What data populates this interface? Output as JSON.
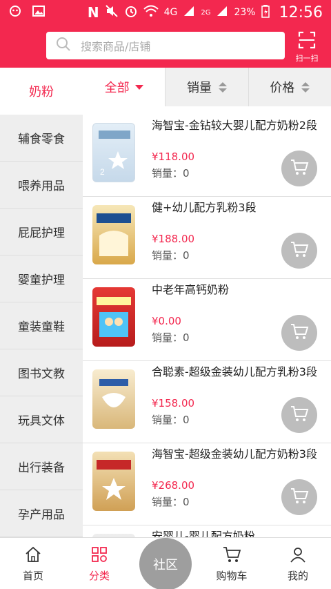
{
  "status_bar": {
    "network": "4G",
    "network2": "2G",
    "battery": "23%",
    "time": "12:56"
  },
  "header": {
    "search_placeholder": "搜索商品/店铺",
    "scan_label": "扫一扫"
  },
  "category": {
    "current": "奶粉",
    "filters": [
      {
        "label": "全部"
      },
      {
        "label": "销量"
      },
      {
        "label": "价格"
      }
    ]
  },
  "sidebar": {
    "items": [
      {
        "label": "辅食零食"
      },
      {
        "label": "喂养用品"
      },
      {
        "label": "屁屁护理"
      },
      {
        "label": "婴童护理"
      },
      {
        "label": "童装童鞋"
      },
      {
        "label": "图书文教"
      },
      {
        "label": "玩具文体"
      },
      {
        "label": "出行装备"
      },
      {
        "label": "孕产用品"
      }
    ]
  },
  "products": [
    {
      "name": "海智宝-金钻较大婴儿配方奶粉2段",
      "price": "¥118.00",
      "sales": "销量：0"
    },
    {
      "name": "健+幼儿配方乳粉3段",
      "price": "¥188.00",
      "sales": "销量：0"
    },
    {
      "name": "中老年高钙奶粉",
      "price": "¥0.00",
      "sales": "销量：0"
    },
    {
      "name": "合聪素-超级金装幼儿配方乳粉3段",
      "price": "¥158.00",
      "sales": "销量：0"
    },
    {
      "name": "海智宝-超级金装幼儿配方奶粉3段",
      "price": "¥268.00",
      "sales": "销量：0"
    },
    {
      "name": "安婴儿-婴儿配方奶粉",
      "price": "",
      "sales": ""
    }
  ],
  "bottom_nav": {
    "home": "首页",
    "category": "分类",
    "community": "社区",
    "cart": "购物车",
    "mine": "我的"
  },
  "colors": {
    "brand": "#f3284f",
    "sidebar_bg": "#eeeeee",
    "cart_button": "#bdbdbd"
  }
}
